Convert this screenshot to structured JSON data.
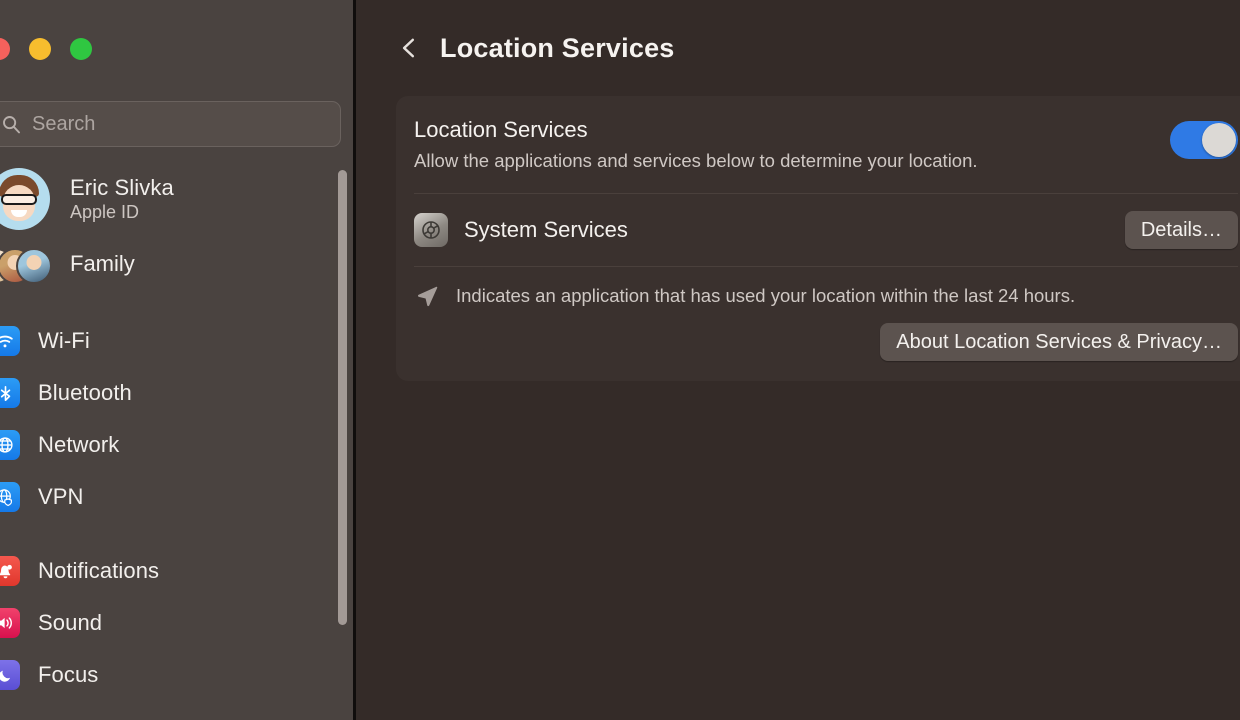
{
  "window": {
    "traffic_lights": [
      {
        "name": "close",
        "color": "#f5615c"
      },
      {
        "name": "minimize",
        "color": "#f7bd2e"
      },
      {
        "name": "maximize",
        "color": "#2fc741"
      }
    ]
  },
  "sidebar": {
    "search": {
      "placeholder": "Search",
      "value": "",
      "icon": "search-icon"
    },
    "account": {
      "name": "Eric Slivka",
      "subtitle": "Apple ID",
      "avatar": "memoji-avatar"
    },
    "family": {
      "label": "Family",
      "avatar": "family-avatars"
    },
    "items": [
      {
        "label": "Wi-Fi",
        "icon": "wifi-icon",
        "color": "#1579e8"
      },
      {
        "label": "Bluetooth",
        "icon": "bluetooth-icon",
        "color": "#1579e8"
      },
      {
        "label": "Network",
        "icon": "globe-icon",
        "color": "#1579e8"
      },
      {
        "label": "VPN",
        "icon": "vpn-shield-icon",
        "color": "#1579e8"
      },
      {
        "label": "Notifications",
        "icon": "bell-icon",
        "color": "#e0372c"
      },
      {
        "label": "Sound",
        "icon": "speaker-icon",
        "color": "#d8104e"
      },
      {
        "label": "Focus",
        "icon": "moon-icon",
        "color": "#5a4ed4"
      }
    ]
  },
  "header": {
    "back_label": "Back",
    "title": "Location Services"
  },
  "main": {
    "location_services": {
      "title": "Location Services",
      "subtitle": "Allow the applications and services below to determine your location.",
      "toggle_on": true,
      "toggle_color": "#2f7ae5"
    },
    "system_services": {
      "label": "System Services",
      "icon": "system-services-gear-icon",
      "details_button": "Details…"
    },
    "footer": {
      "note_icon": "location-arrow-icon",
      "note": "Indicates an application that has used your location within the last 24 hours.",
      "about_button": "About Location Services & Privacy…"
    }
  }
}
